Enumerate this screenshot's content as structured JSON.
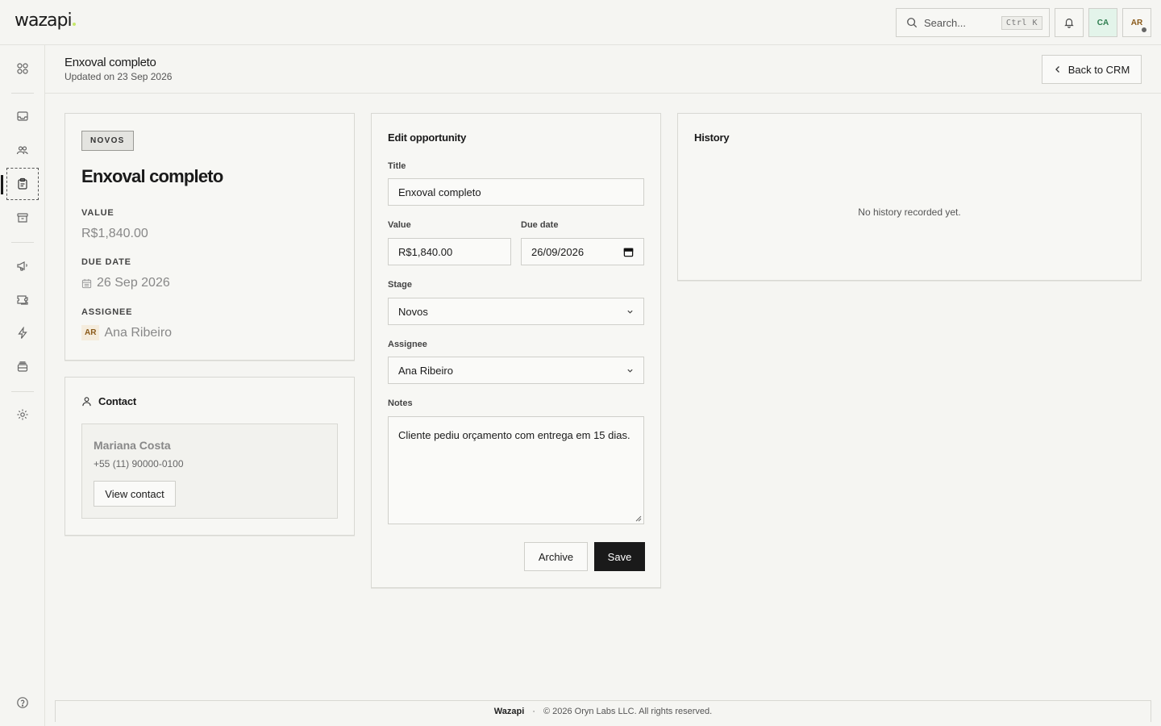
{
  "app": {
    "logo": "wazapi"
  },
  "topbar": {
    "search_placeholder": "Search...",
    "search_shortcut": "Ctrl K",
    "org_avatar": "CA",
    "user_avatar": "AR"
  },
  "sidebar": {
    "icons": [
      "grid-icon",
      "inbox-icon",
      "users-icon",
      "clipboard-icon",
      "archive-icon",
      "megaphone-icon",
      "tickets-icon",
      "bolt-icon",
      "stack-icon",
      "gear-icon",
      "help-icon"
    ],
    "active": "clipboard-icon"
  },
  "header": {
    "title": "Enxoval completo",
    "subtitle": "Updated on 23 Sep 2026",
    "back_label": "Back to CRM"
  },
  "summary": {
    "stage": "NOVOS",
    "title": "Enxoval completo",
    "value_label": "VALUE",
    "value": "R$1,840.00",
    "due_label": "DUE DATE",
    "due": "26 Sep 2026",
    "assignee_label": "ASSIGNEE",
    "assignee_initials": "AR",
    "assignee": "Ana Ribeiro"
  },
  "contact": {
    "section_title": "Contact",
    "name": "Mariana Costa",
    "phone": "+55 (11) 90000-0100",
    "view_label": "View contact"
  },
  "edit": {
    "section_title": "Edit opportunity",
    "title_label": "Title",
    "title_value": "Enxoval completo",
    "value_label": "Value",
    "value_value": "R$1,840.00",
    "due_label": "Due date",
    "due_value": "26/09/2026",
    "stage_label": "Stage",
    "stage_value": "Novos",
    "assignee_label": "Assignee",
    "assignee_value": "Ana Ribeiro",
    "notes_label": "Notes",
    "notes_value": "Cliente pediu orçamento com entrega em 15 dias.",
    "archive_label": "Archive",
    "save_label": "Save"
  },
  "history": {
    "section_title": "History",
    "empty": "No history recorded yet."
  },
  "footer": {
    "brand": "Wazapi",
    "separator": "·",
    "copyright": "© 2026 Oryn Labs LLC. All rights reserved."
  }
}
